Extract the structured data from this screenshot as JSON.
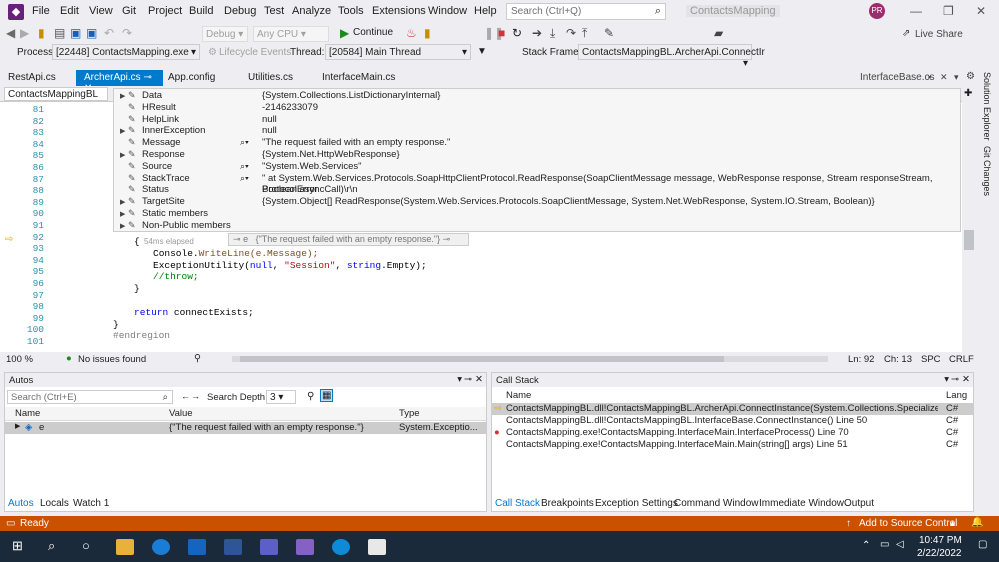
{
  "menubar": {
    "items": [
      "File",
      "Edit",
      "View",
      "Git",
      "Project",
      "Build",
      "Debug",
      "Test",
      "Analyze",
      "Tools",
      "Extensions",
      "Window",
      "Help"
    ],
    "search_placeholder": "Search (Ctrl+Q)",
    "app_title": "ContactsMapping",
    "avatar_initials": "PR"
  },
  "toolbar": {
    "config": "Debug",
    "platform": "Any CPU",
    "continue_label": "Continue",
    "live_share": "Live Share"
  },
  "debugbar": {
    "process_label": "Process:",
    "process_value": "[22448] ContactsMapping.exe",
    "lifecycle_label": "Lifecycle Events",
    "thread_label": "Thread:",
    "thread_value": "[20584] Main Thread",
    "stackframe_label": "Stack Frame:",
    "stackframe_value": "ContactsMappingBL.ArcherApi.ConnectIr"
  },
  "tabs": [
    "RestApi.cs",
    "ArcherApi.cs",
    "App.config",
    "Utilities.cs",
    "InterfaceMain.cs"
  ],
  "tab_right": "InterfaceBase.cs",
  "editor": {
    "project": "ContactsMappingBL",
    "lines": [
      "81",
      "82",
      "83",
      "84",
      "85",
      "86",
      "87",
      "88",
      "89",
      "90",
      "91",
      "92",
      "93",
      "94",
      "95",
      "96",
      "97",
      "98",
      "99",
      "100",
      "101"
    ],
    "code92": "{",
    "code93a": "Console.",
    "code93b": "WriteLine(e.Message);",
    "code94a": "ExceptionUtility(",
    "code94b": "null",
    "code94c": ", ",
    "code94d": "\"Session\"",
    "code94e": ", ",
    "code94f": "string",
    "code94g": ".Empty);",
    "code95": "//throw;",
    "code96": "}",
    "code98a": "return",
    "code98b": " connectExists;",
    "code99": "}",
    "code100": "#endregion",
    "elapsed": "54ms elapsed",
    "tip_name": "e",
    "tip_value": "{\"The request failed with an empty response.\"}"
  },
  "datatip": {
    "names": [
      "Data",
      "HResult",
      "HelpLink",
      "InnerException",
      "Message",
      "Response",
      "Source",
      "StackTrace",
      "Status",
      "TargetSite",
      "Static members",
      "Non-Public members"
    ],
    "values": [
      "{System.Collections.ListDictionaryInternal}",
      "-2146233079",
      "null",
      "null",
      "\"The request failed with an empty response.\"",
      "{System.Net.HttpWebResponse}",
      "\"System.Web.Services\"",
      "\"   at System.Web.Services.Protocols.SoapHttpClientProtocol.ReadResponse(SoapClientMessage message, WebResponse response, Stream responseStream, Boolean asyncCall)\\r\\n",
      "ProtocolError",
      "{System.Object[] ReadResponse(System.Web.Services.Protocols.SoapClientMessage, System.Net.WebResponse, System.IO.Stream, Boolean)}",
      "",
      ""
    ]
  },
  "editor_status": {
    "zoom": "100 %",
    "issues": "No issues found",
    "ln": "Ln: 92",
    "ch": "Ch: 13",
    "spc": "SPC",
    "crlf": "CRLF"
  },
  "autos": {
    "title": "Autos",
    "search_placeholder": "Search (Ctrl+E)",
    "depth_label": "Search Depth:",
    "depth_value": "3",
    "cols": [
      "Name",
      "Value",
      "Type"
    ],
    "row_name": "e",
    "row_value": "{\"The request failed with an empty response.\"}",
    "row_type": "System.Exceptio..."
  },
  "callstack": {
    "title": "Call Stack",
    "cols": [
      "Name",
      "Lang"
    ],
    "rows": [
      {
        "name": "ContactsMappingBL.dll!ContactsMappingBL.ArcherApi.ConnectInstance(System.Collections.Specialized.Name...",
        "lang": "C#"
      },
      {
        "name": "ContactsMappingBL.dll!ContactsMappingBL.InterfaceBase.ConnectInstance() Line 50",
        "lang": "C#"
      },
      {
        "name": "ContactsMapping.exe!ContactsMapping.InterfaceMain.InterfaceProcess() Line 70",
        "lang": "C#"
      },
      {
        "name": "ContactsMapping.exe!ContactsMapping.InterfaceMain.Main(string[] args) Line 51",
        "lang": "C#"
      }
    ]
  },
  "bottom_tabs_left": [
    "Autos",
    "Locals",
    "Watch 1"
  ],
  "bottom_tabs_right": [
    "Call Stack",
    "Breakpoints",
    "Exception Settings",
    "Command Window",
    "Immediate Window",
    "Output"
  ],
  "right_side": [
    "Solution Explorer",
    "Git Changes"
  ],
  "status": {
    "ready": "Ready",
    "source_control": "Add to Source Control"
  },
  "taskbar": {
    "time": "10:47 PM",
    "date": "2/22/2022"
  },
  "colors": {
    "accent": "#007acc",
    "status": "#ca5100",
    "taskbar": "#1b2a3a"
  }
}
